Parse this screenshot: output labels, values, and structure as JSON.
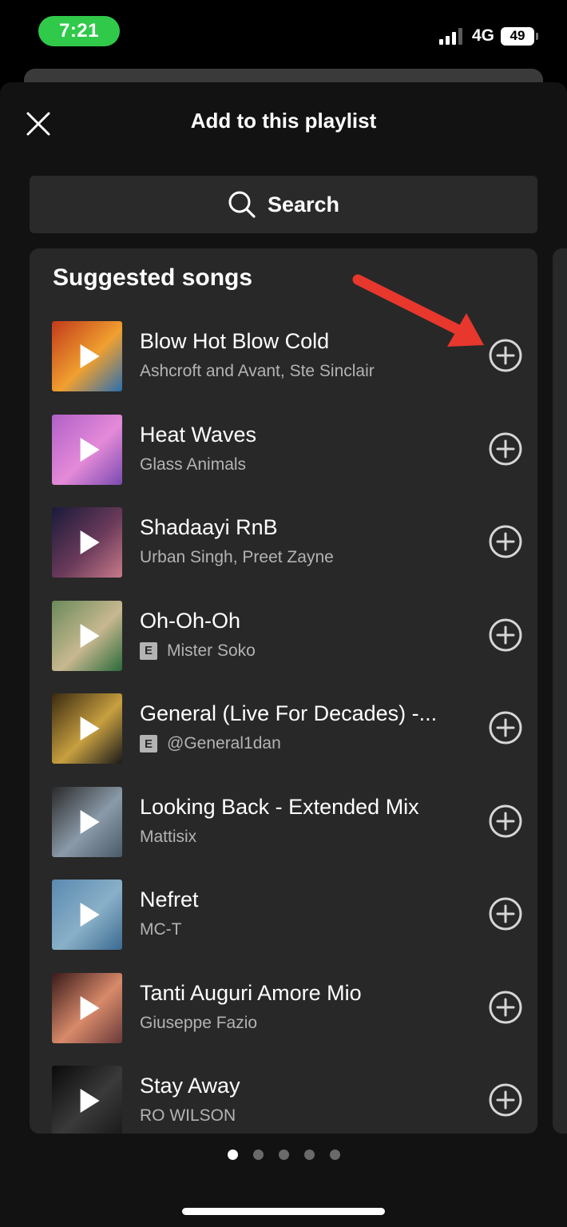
{
  "status_bar": {
    "time": "7:21",
    "network": "4G",
    "battery": "49",
    "time_pill_color": "#30c94a"
  },
  "sheet": {
    "title": "Add to this playlist",
    "close_icon": "close-icon"
  },
  "search": {
    "label": "Search",
    "icon": "search-icon"
  },
  "suggested": {
    "title": "Suggested songs",
    "songs": [
      {
        "title": "Blow Hot Blow Cold",
        "artist": "Ashcroft and Avant, Ste Sinclair",
        "explicit": false,
        "art_colors": [
          "#c23a1a",
          "#f0a030",
          "#2a6fb0"
        ]
      },
      {
        "title": "Heat Waves",
        "artist": "Glass Animals",
        "explicit": false,
        "art_colors": [
          "#b060c8",
          "#e48ad8",
          "#7a4ab0"
        ]
      },
      {
        "title": "Shadaayi RnB",
        "artist": "Urban Singh, Preet Zayne",
        "explicit": false,
        "art_colors": [
          "#1a1a3a",
          "#6a3a5a",
          "#c87a8a"
        ]
      },
      {
        "title": "Oh-Oh-Oh",
        "artist": "Mister Soko",
        "explicit": true,
        "explicit_label": "E",
        "art_colors": [
          "#6a8a5a",
          "#c8b890",
          "#2a6a3a"
        ]
      },
      {
        "title": "General (Live For Decades) -...",
        "artist": "@General1dan",
        "explicit": true,
        "explicit_label": "E",
        "art_colors": [
          "#3a2a10",
          "#c8a040",
          "#1a1a1a"
        ]
      },
      {
        "title": "Looking Back - Extended Mix",
        "artist": "Mattisix",
        "explicit": false,
        "art_colors": [
          "#2a2a2a",
          "#8a9aa8",
          "#4a5a68"
        ]
      },
      {
        "title": "Nefret",
        "artist": "MC-T",
        "explicit": false,
        "art_colors": [
          "#5a8ab0",
          "#8ab0c8",
          "#3a6a90"
        ]
      },
      {
        "title": "Tanti Auguri Amore Mio",
        "artist": "Giuseppe Fazio",
        "explicit": false,
        "art_colors": [
          "#3a1a1a",
          "#d88a6a",
          "#6a3a3a"
        ]
      },
      {
        "title": "Stay Away",
        "artist": "RO WILSON",
        "explicit": false,
        "art_colors": [
          "#0a0a0a",
          "#3a3a3a",
          "#1a1a1a"
        ]
      }
    ]
  },
  "pagination": {
    "count": 5,
    "active": 0
  },
  "colors": {
    "background": "#121212",
    "panel": "#282828",
    "secondary_text": "#b3b3b3",
    "annotation_arrow": "#e8372c"
  }
}
